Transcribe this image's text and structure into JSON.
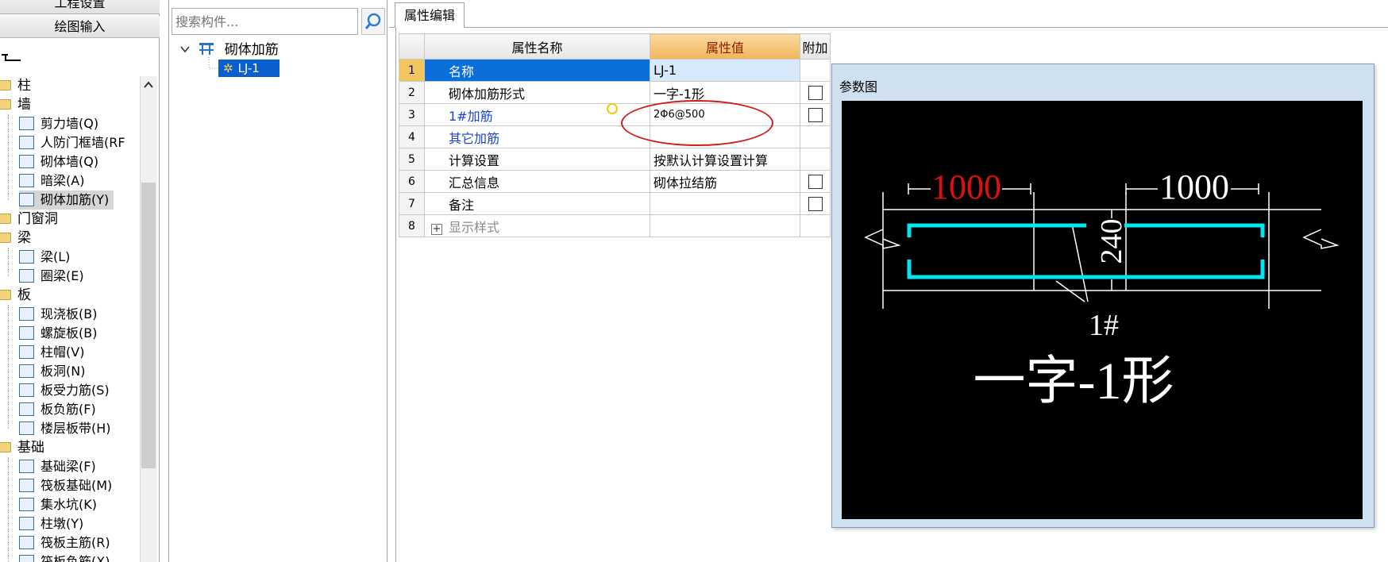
{
  "nav": {
    "top_buttons": [
      "工程设置",
      "绘图输入"
    ]
  },
  "left_tree": {
    "categories": [
      {
        "label": "柱",
        "items": []
      },
      {
        "label": "墙",
        "items": [
          "剪力墙(Q)",
          "人防门框墙(RF",
          "砌体墙(Q)",
          "暗梁(A)",
          "砌体加筋(Y)"
        ]
      },
      {
        "label": "门窗洞",
        "items": []
      },
      {
        "label": "梁",
        "items": [
          "梁(L)",
          "圈梁(E)"
        ]
      },
      {
        "label": "板",
        "items": [
          "现浇板(B)",
          "螺旋板(B)",
          "柱帽(V)",
          "板洞(N)",
          "板受力筋(S)",
          "板负筋(F)",
          "楼层板带(H)"
        ]
      },
      {
        "label": "基础",
        "items": [
          "基础梁(F)",
          "筏板基础(M)",
          "集水坑(K)",
          "柱墩(Y)",
          "筏板主筋(R)",
          "筏板负筋(X)"
        ]
      }
    ],
    "selected_item": "砌体加筋(Y)"
  },
  "search": {
    "placeholder": "搜索构件..."
  },
  "component_tree": {
    "root": "砌体加筋",
    "child": "LJ-1"
  },
  "tabs": {
    "properties": "属性编辑"
  },
  "prop_table": {
    "headers": {
      "name": "属性名称",
      "value": "属性值",
      "extra": "附加"
    },
    "rows": [
      {
        "num": "1",
        "name": "名称",
        "value": "LJ-1",
        "checkbox": false
      },
      {
        "num": "2",
        "name": "砌体加筋形式",
        "value": "一字-1形",
        "checkbox": true
      },
      {
        "num": "3",
        "name": "1#加筋",
        "value": "2Φ6@500",
        "checkbox": true
      },
      {
        "num": "4",
        "name": "其它加筋",
        "value": "",
        "checkbox": false
      },
      {
        "num": "5",
        "name": "计算设置",
        "value": "按默认计算设置计算",
        "checkbox": false
      },
      {
        "num": "6",
        "name": "汇总信息",
        "value": "砌体拉结筋",
        "checkbox": true
      },
      {
        "num": "7",
        "name": "备注",
        "value": "",
        "checkbox": true
      },
      {
        "num": "8",
        "name": "显示样式",
        "value": "",
        "checkbox": false
      }
    ]
  },
  "param_dialog": {
    "title": "参数图",
    "left_length": "1000",
    "right_length": "1000",
    "thickness": "240",
    "bar_label": "1#",
    "shape_name": "一字-1形",
    "colors": {
      "highlight": "#e01010",
      "rebar": "#00e5ee",
      "lines": "#ffffff",
      "background": "#000000"
    }
  }
}
